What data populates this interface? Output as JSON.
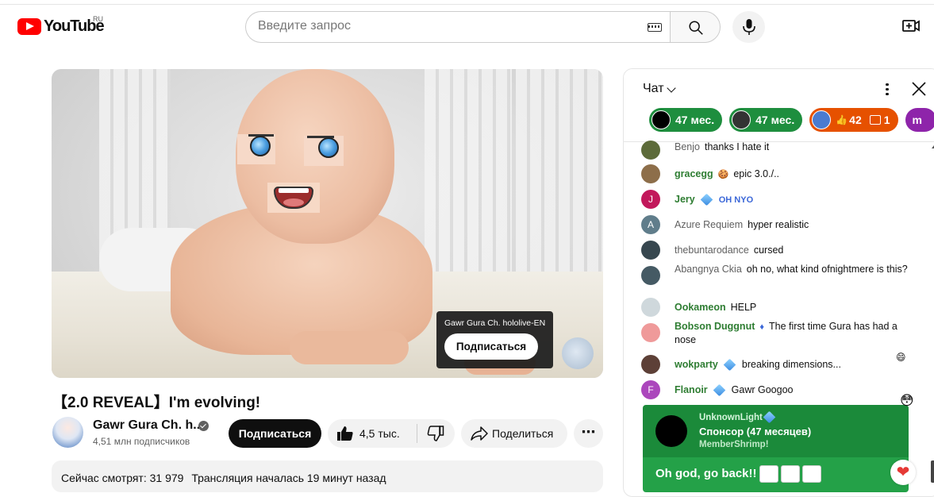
{
  "header": {
    "logo_text": "YouTube",
    "region": "RU",
    "search_placeholder": "Введите запрос",
    "icons": [
      "keyboard-icon",
      "search-icon",
      "mic-icon",
      "create-video-icon"
    ]
  },
  "video": {
    "popup_channel": "Gawr Gura Ch. hololive-EN",
    "popup_subscribe": "Подписаться",
    "title": "【2.0 REVEAL】I'm evolving!",
    "channel_name": "Gawr Gura Ch. h...",
    "subscribers": "4,51 млн подписчиков",
    "subscribe_label": "Подписаться",
    "likes": "4,5 тыс.",
    "share_label": "Поделиться",
    "more_label": "⋯",
    "watching_now": "Сейчас смотрят: 31 979",
    "stream_started": "Трансляция началась 19 минут назад"
  },
  "chat": {
    "title": "Чат",
    "ticker": [
      {
        "label": "47 мес.",
        "color": "#1e8e3e"
      },
      {
        "label": "47 мес.",
        "color": "#1e8e3e"
      },
      {
        "label": "42",
        "extra": "1",
        "color": "#e65100"
      },
      {
        "label": "m",
        "color": "#8e24aa"
      }
    ],
    "messages": [
      {
        "author": "Benjo",
        "text": "thanks I hate it",
        "avatar_color": "#5d6b3a"
      },
      {
        "author": "gracegg",
        "text": "epic 3.0./..",
        "avatar_color": "#8d6e4a"
      },
      {
        "author": "Jery",
        "text": "OH  NYO",
        "avatar_color": "#c2185b",
        "initial": "J"
      },
      {
        "author": "Azure Requiem",
        "text": "hyper realistic",
        "avatar_color": "#607d8b",
        "initial": "A"
      },
      {
        "author": "thebuntarodance",
        "text": "cursed",
        "avatar_color": "#37474f"
      },
      {
        "author": "Abangnya Ckia",
        "text": "oh no, what kind ofnightmere is this?",
        "avatar_color": "#455a64"
      },
      {
        "author": "Ookameon",
        "text": "HELP",
        "avatar_color": "#cfd8dc"
      },
      {
        "author": "Bobson Duggnut",
        "text": "The first time Gura has had a nose",
        "avatar_color": "#ef9a9a"
      },
      {
        "author": "wokparty",
        "text": "breaking dimensions...",
        "avatar_color": "#5d4037"
      },
      {
        "author": "Flanoir",
        "text": "Gawr Googoo",
        "avatar_color": "#ab47bc",
        "initial": "F"
      }
    ],
    "membership": {
      "name": "UnknownLight",
      "title": "Спонсор (47 месяцев)",
      "tier": "MemberShrimp!",
      "message": "Oh god, go back!!"
    }
  }
}
